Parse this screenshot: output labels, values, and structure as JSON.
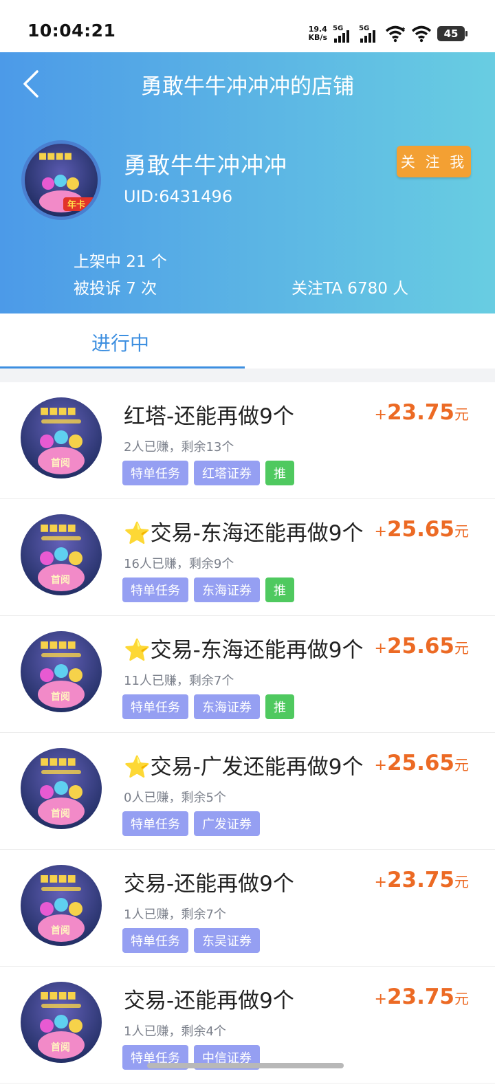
{
  "status_bar": {
    "time": "10:04:21",
    "net_speed_value": "19.4",
    "net_speed_unit": "KB/s",
    "signal_label_1": "5G",
    "signal_label_2": "5G",
    "battery": "45"
  },
  "header": {
    "title": "勇敢牛牛冲冲冲的店铺",
    "shop_name": "勇敢牛牛冲冲冲",
    "uid": "UID:6431496",
    "follow_button": "关 注 我",
    "listed": "上架中 21 个",
    "complaints": "被投诉 7 次",
    "followers": "关注TA 6780 人",
    "avatar_badge": "年卡"
  },
  "tabs": [
    {
      "label": "进行中",
      "active": true
    }
  ],
  "colors": {
    "accent_blue": "#3d8fe0",
    "price_orange": "#ec6a24",
    "follow_button": "#f3a033",
    "tag_purple": "#959ff2",
    "tag_green": "#4fc95f"
  },
  "thumb_text": "首阅",
  "items": [
    {
      "star": "",
      "title": "红塔-还能再做9个",
      "earned": "2人已赚，剩余13个",
      "plus": "+",
      "price": "23.75",
      "unit": "元",
      "tags": [
        "特单任务",
        "红塔证券"
      ],
      "recommend": "推"
    },
    {
      "star": "⭐",
      "title": "交易-东海还能再做9个",
      "earned": "16人已赚，剩余9个",
      "plus": "+",
      "price": "25.65",
      "unit": "元",
      "tags": [
        "特单任务",
        "东海证券"
      ],
      "recommend": "推"
    },
    {
      "star": "⭐",
      "title": "交易-东海还能再做9个",
      "earned": "11人已赚，剩余7个",
      "plus": "+",
      "price": "25.65",
      "unit": "元",
      "tags": [
        "特单任务",
        "东海证券"
      ],
      "recommend": "推"
    },
    {
      "star": "⭐",
      "title": "交易-广发还能再做9个",
      "earned": "0人已赚，剩余5个",
      "plus": "+",
      "price": "25.65",
      "unit": "元",
      "tags": [
        "特单任务",
        "广发证券"
      ],
      "recommend": ""
    },
    {
      "star": "",
      "title": "交易-还能再做9个",
      "earned": "1人已赚，剩余7个",
      "plus": "+",
      "price": "23.75",
      "unit": "元",
      "tags": [
        "特单任务",
        "东吴证券"
      ],
      "recommend": ""
    },
    {
      "star": "",
      "title": "交易-还能再做9个",
      "earned": "1人已赚，剩余4个",
      "plus": "+",
      "price": "23.75",
      "unit": "元",
      "tags": [
        "特单任务",
        "中信证券"
      ],
      "recommend": ""
    }
  ]
}
